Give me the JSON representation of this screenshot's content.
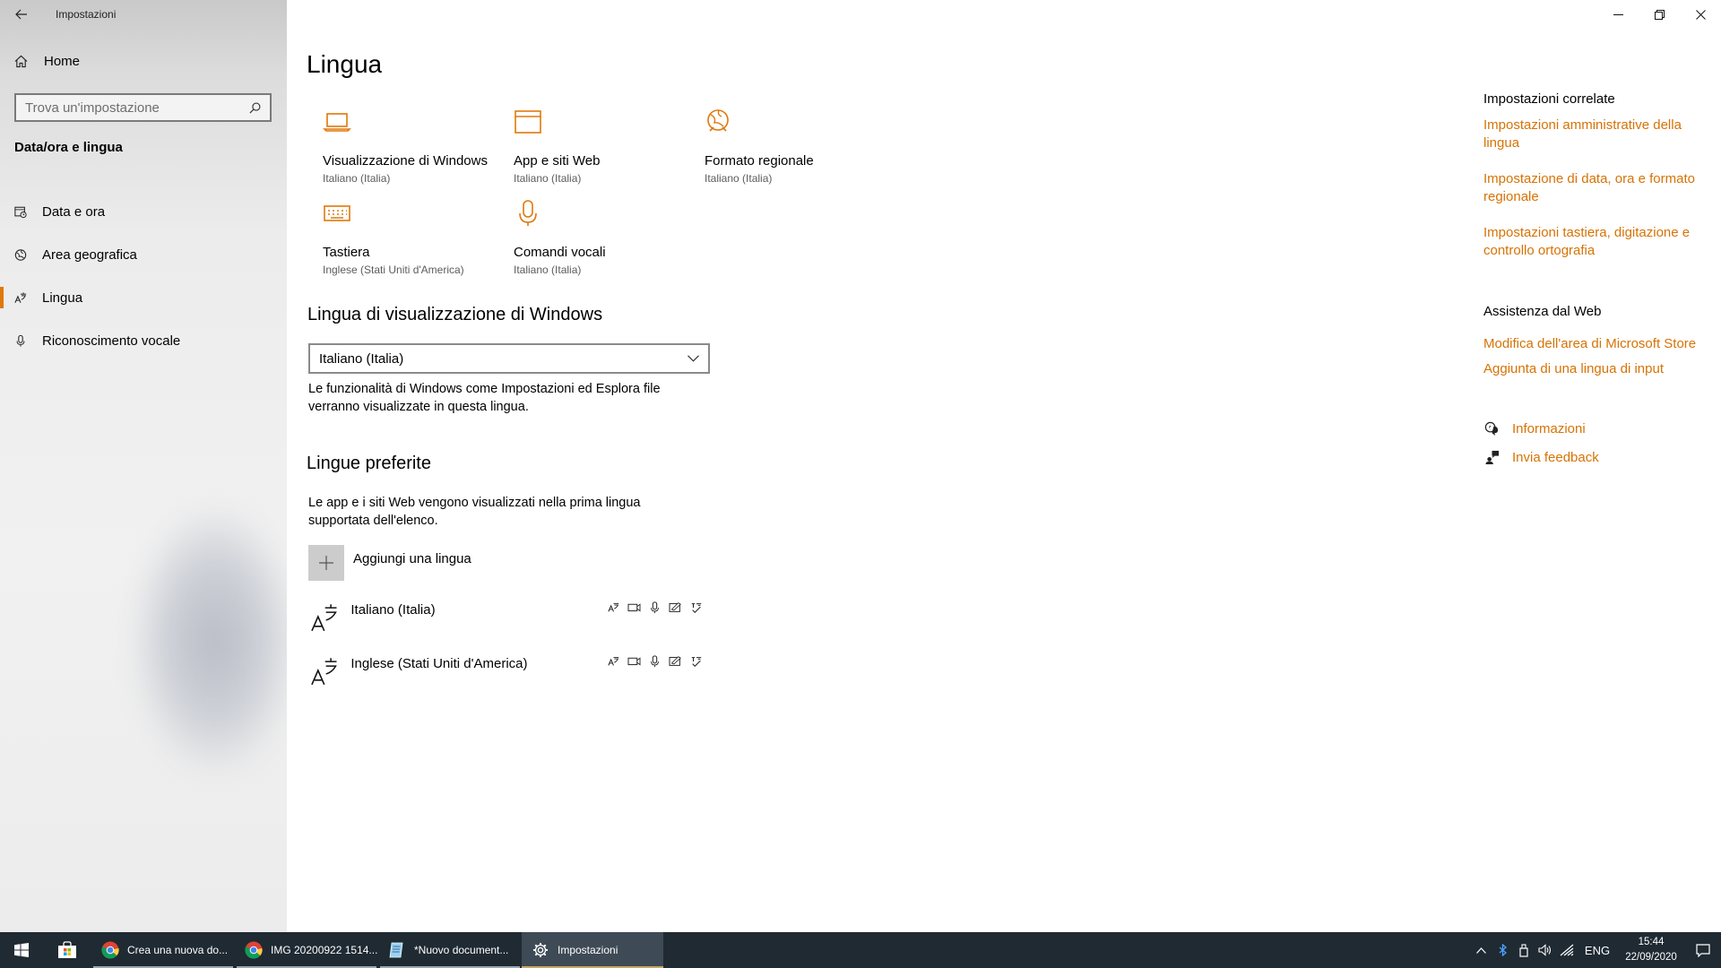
{
  "window": {
    "title": "Impostazioni",
    "controls": {
      "minimize": "─",
      "restore": "❐",
      "close": "✕"
    }
  },
  "sidebar": {
    "home_label": "Home",
    "search_placeholder": "Trova un'impostazione",
    "section_label": "Data/ora e lingua",
    "items": [
      {
        "label": "Data e ora",
        "icon": "calendar-clock-icon",
        "active": false
      },
      {
        "label": "Area geografica",
        "icon": "globe-icon",
        "active": false
      },
      {
        "label": "Lingua",
        "icon": "language-icon",
        "active": true
      },
      {
        "label": "Riconoscimento vocale",
        "icon": "microphone-icon",
        "active": false
      }
    ]
  },
  "main": {
    "title": "Lingua",
    "tiles": [
      {
        "name": "Visualizzazione di Windows",
        "sub": "Italiano (Italia)",
        "icon": "laptop-icon"
      },
      {
        "name": "App e siti Web",
        "sub": "Italiano (Italia)",
        "icon": "browser-window-icon"
      },
      {
        "name": "Formato regionale",
        "sub": "Italiano (Italia)",
        "icon": "globe-settings-icon"
      },
      {
        "name": "Tastiera",
        "sub": "Inglese (Stati Uniti d'America)",
        "icon": "keyboard-icon"
      },
      {
        "name": "Comandi vocali",
        "sub": "Italiano (Italia)",
        "icon": "microphone-icon"
      }
    ],
    "display_language": {
      "heading": "Lingua di visualizzazione di Windows",
      "selected": "Italiano (Italia)",
      "description": "Le funzionalità di Windows come Impostazioni ed Esplora file verranno visualizzate in questa lingua."
    },
    "preferred": {
      "heading": "Lingue preferite",
      "description": "Le app e i siti Web vengono visualizzati nella prima lingua supportata dell'elenco.",
      "add_label": "Aggiungi una lingua",
      "languages": [
        {
          "name": "Italiano (Italia)"
        },
        {
          "name": "Inglese (Stati Uniti d'America)"
        }
      ]
    }
  },
  "related": {
    "heading": "Impostazioni correlate",
    "links": [
      "Impostazioni amministrative della lingua",
      "Impostazione di data, ora e formato regionale",
      "Impostazioni tastiera, digitazione e controllo ortografia"
    ],
    "web_heading": "Assistenza dal Web",
    "web_links": [
      "Modifica dell'area di Microsoft Store",
      "Aggiunta di una lingua di input"
    ],
    "help": [
      {
        "label": "Informazioni",
        "icon": "help-chat-icon"
      },
      {
        "label": "Invia feedback",
        "icon": "feedback-icon"
      }
    ]
  },
  "taskbar": {
    "apps": [
      {
        "label": "Crea una nuova do...",
        "icon": "chrome-icon",
        "active": false
      },
      {
        "label": "IMG 20200922 1514...",
        "icon": "chrome-icon",
        "active": false
      },
      {
        "label": "*Nuovo document...",
        "icon": "notepad-icon",
        "active": false
      },
      {
        "label": "Impostazioni",
        "icon": "gear-icon",
        "active": true
      }
    ],
    "language": "ENG",
    "time": "15:44",
    "date": "22/09/2020"
  },
  "colors": {
    "accent": "#e0780a",
    "link": "#d67305",
    "taskbar": "#1f2a33"
  }
}
